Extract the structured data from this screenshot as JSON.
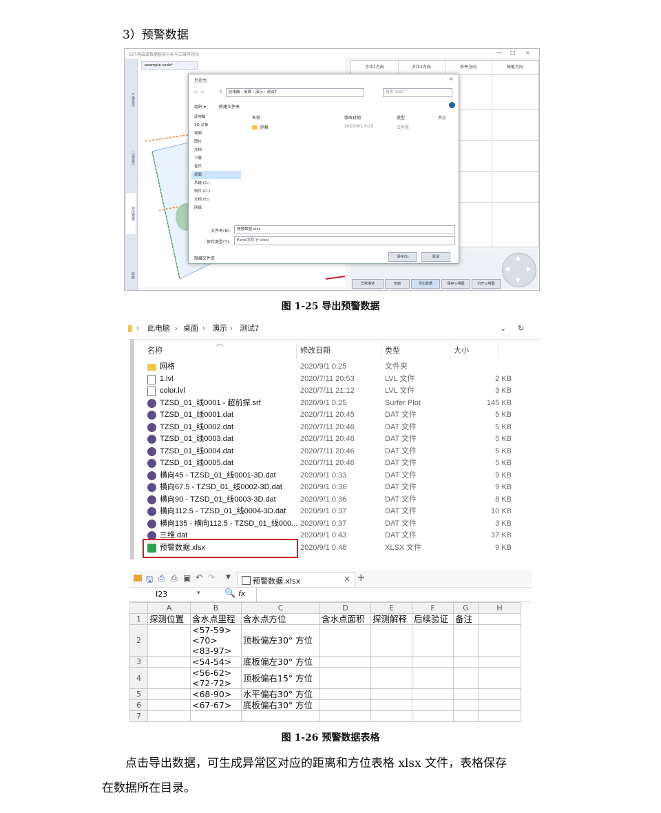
{
  "section_title": "3）预警数据",
  "fig25": {
    "caption": "图 1-25  导出预警数据",
    "window_title": "钻孔电磁波数据智能分析与三维可视化",
    "tab": "example.vsdx*",
    "left_tabs": [
      "三维显示",
      "三维显示",
      "导出数据",
      "导航"
    ],
    "table_headers": [
      "方位1方向",
      "方位2方向",
      "水平方向",
      "底板方向"
    ],
    "bottom_buttons": [
      "异常描述",
      "剖面",
      "导出数据",
      "保存三维图",
      "打开三维图"
    ],
    "dialog": {
      "title": "另存为",
      "path": "此电脑 › 桌面 › 演示 › 测试7",
      "search_placeholder": "搜索\"测试7\"",
      "organize": "组织 ▾",
      "new_folder": "新建文件夹",
      "col_name": "名称",
      "col_date": "修改日期",
      "col_type": "类型",
      "col_size": "大小",
      "folder_name": "网格",
      "folder_date": "2020/9/1 0:25",
      "folder_type": "文件夹",
      "sidebar": [
        "此电脑",
        "3D 对象",
        "视频",
        "图片",
        "文档",
        "下载",
        "音乐",
        "桌面",
        "系统 (C:)",
        "软件 (D:)",
        "文档 (E:)",
        "网络"
      ],
      "filename_label": "文件名(N):",
      "filename": "预警数据.xlsx",
      "filetype_label": "保存类型(T):",
      "filetype": "Excel文件 (*.xlsx)",
      "hide_folders": "隐藏文件夹",
      "save": "保存(S)",
      "cancel": "取消"
    }
  },
  "explorer": {
    "path": [
      "此电脑",
      "桌面",
      "演示",
      "测试7"
    ],
    "columns": [
      "名称",
      "修改日期",
      "类型",
      "大小"
    ],
    "files": [
      {
        "name": "网格",
        "date": "2020/9/1 0:25",
        "type": "文件夹",
        "size": "",
        "icon": "folder-icon"
      },
      {
        "name": "1.lvl",
        "date": "2020/7/11 20:53",
        "type": "LVL 文件",
        "size": "2 KB",
        "icon": "file-icon"
      },
      {
        "name": "color.lvl",
        "date": "2020/7/11 21:12",
        "type": "LVL 文件",
        "size": "3 KB",
        "icon": "file-icon"
      },
      {
        "name": "TZSD_01_线0001 - 超前探.srf",
        "date": "2020/9/1 0:25",
        "type": "Surfer Plot",
        "size": "145 KB",
        "icon": "surfer-icon"
      },
      {
        "name": "TZSD_01_线0001.dat",
        "date": "2020/7/11 20:45",
        "type": "DAT 文件",
        "size": "5 KB",
        "icon": "surfer-icon"
      },
      {
        "name": "TZSD_01_线0002.dat",
        "date": "2020/7/11 20:46",
        "type": "DAT 文件",
        "size": "5 KB",
        "icon": "surfer-icon"
      },
      {
        "name": "TZSD_01_线0003.dat",
        "date": "2020/7/11 20:46",
        "type": "DAT 文件",
        "size": "5 KB",
        "icon": "surfer-icon"
      },
      {
        "name": "TZSD_01_线0004.dat",
        "date": "2020/7/11 20:46",
        "type": "DAT 文件",
        "size": "5 KB",
        "icon": "surfer-icon"
      },
      {
        "name": "TZSD_01_线0005.dat",
        "date": "2020/7/11 20:46",
        "type": "DAT 文件",
        "size": "5 KB",
        "icon": "surfer-icon"
      },
      {
        "name": "横向45 - TZSD_01_线0001-3D.dat",
        "date": "2020/9/1 0:33",
        "type": "DAT 文件",
        "size": "9 KB",
        "icon": "surfer-icon"
      },
      {
        "name": "横向67.5 - TZSD_01_线0002-3D.dat",
        "date": "2020/9/1 0:36",
        "type": "DAT 文件",
        "size": "9 KB",
        "icon": "surfer-icon"
      },
      {
        "name": "横向90 - TZSD_01_线0003-3D.dat",
        "date": "2020/9/1 0:36",
        "type": "DAT 文件",
        "size": "8 KB",
        "icon": "surfer-icon"
      },
      {
        "name": "横向112.5 - TZSD_01_线0004-3D.dat",
        "date": "2020/9/1 0:37",
        "type": "DAT 文件",
        "size": "10 KB",
        "icon": "surfer-icon"
      },
      {
        "name": "横向135 - 横向112.5 - TZSD_01_线000...",
        "date": "2020/9/1 0:37",
        "type": "DAT 文件",
        "size": "3 KB",
        "icon": "surfer-icon"
      },
      {
        "name": "三维.dat",
        "date": "2020/9/1 0:43",
        "type": "DAT 文件",
        "size": "37 KB",
        "icon": "surfer-icon"
      },
      {
        "name": "预警数据.xlsx",
        "date": "2020/9/1 0:48",
        "type": "XLSX 文件",
        "size": "9 KB",
        "icon": "xlsx-icon"
      }
    ]
  },
  "sheet": {
    "tab_name": "预警数据.xlsx",
    "cell_ref": "I23",
    "fx": "fx",
    "col_letters": [
      "A",
      "B",
      "C",
      "D",
      "E",
      "F",
      "G",
      "H"
    ],
    "headers": [
      "探测位置",
      "含水点里程",
      "含水点方位",
      "含水点面积",
      "探测解释",
      "后续验证",
      "备注"
    ],
    "rows": [
      {
        "n": "2",
        "b": [
          "<57-59>",
          "<70>",
          "<83-97>"
        ],
        "c": "顶板偏左30° 方位"
      },
      {
        "n": "3",
        "b": [
          "<54-54>"
        ],
        "c": "底板偏左30° 方位"
      },
      {
        "n": "4",
        "b": [
          "<56-62>",
          "<72-72>"
        ],
        "c": "顶板偏右15° 方位"
      },
      {
        "n": "5",
        "b": [
          "<68-90>"
        ],
        "c": "水平偏右30° 方位"
      },
      {
        "n": "6",
        "b": [
          "<67-67>"
        ],
        "c": "底板偏右30° 方位"
      },
      {
        "n": "7",
        "b": [],
        "c": ""
      }
    ]
  },
  "fig26_caption": "图 1-26 预警数据表格",
  "paragraph_line1": "点击导出数据，可生成异常区对应的距离和方位表格 xlsx 文件，表格保存",
  "paragraph_line2": "在数据所在目录。"
}
